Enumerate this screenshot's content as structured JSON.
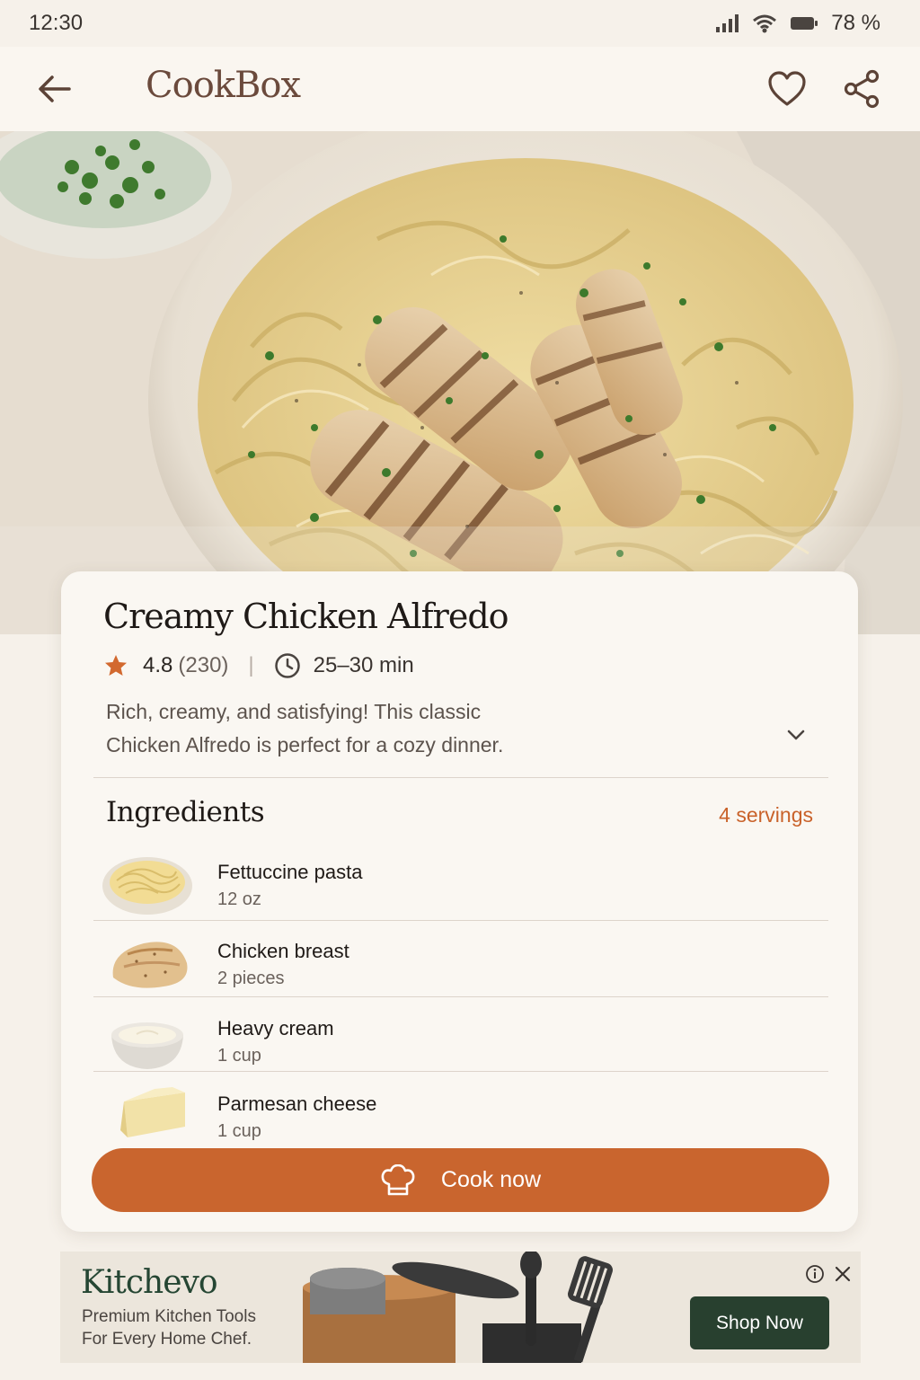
{
  "status_bar": {
    "time": "12:30",
    "battery": "78 %"
  },
  "app_bar": {
    "title": "CookBox"
  },
  "recipe": {
    "title": "Creamy Chicken Alfredo",
    "rating": "4.8",
    "rating_count": "(230)",
    "separator": "|",
    "time": "25–30 min",
    "description_line1": "Rich, creamy, and satisfying! This classic",
    "description_line2": "Chicken Alfredo is perfect for a cozy dinner."
  },
  "ingredients": {
    "heading": "Ingredients",
    "servings": "4 servings",
    "items": [
      {
        "name": "Fettuccine pasta",
        "qty": "12 oz",
        "icon": "pasta-bowl"
      },
      {
        "name": "Chicken breast",
        "qty": "2 pieces",
        "icon": "chicken-breast"
      },
      {
        "name": "Heavy cream",
        "qty": "1 cup",
        "icon": "cream-bowl"
      },
      {
        "name": "Parmesan cheese",
        "qty": "1 cup",
        "icon": "cheese-wedge"
      }
    ]
  },
  "cook_button": {
    "label": "Cook now",
    "icon": "chef-hat"
  },
  "ad": {
    "brand": "Kitchevo",
    "tagline_line1": "Premium Kitchen Tools",
    "tagline_line2": "For Every Home Chef.",
    "cta": "Shop Now"
  },
  "colors": {
    "accent": "#c9652e",
    "brand_title": "#6b4a3c",
    "ad_green": "#28402f",
    "star": "#d2692f"
  }
}
